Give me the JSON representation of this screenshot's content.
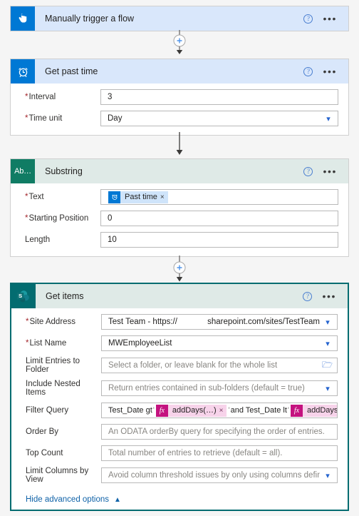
{
  "trigger_card": {
    "title": "Manually trigger a flow",
    "icon": "tap-hand-icon",
    "help": "?",
    "menu": "•••"
  },
  "past_time_card": {
    "title": "Get past time",
    "icon": "alarm-clock-icon",
    "help": "?",
    "menu": "•••",
    "fields": [
      {
        "label": "Interval",
        "required": true,
        "value": "3",
        "control": "text"
      },
      {
        "label": "Time unit",
        "required": true,
        "value": "Day",
        "control": "dropdown"
      }
    ]
  },
  "substring_card": {
    "title": "Substring",
    "icon_text": "Ab…",
    "help": "?",
    "menu": "•••",
    "text_label": "Text",
    "text_token": {
      "icon": "alarm-clock-icon",
      "label": "Past time",
      "remove": "×"
    },
    "fields": [
      {
        "label": "Starting Position",
        "required": true,
        "value": "0",
        "control": "text"
      },
      {
        "label": "Length",
        "required": false,
        "value": "10",
        "control": "text"
      }
    ]
  },
  "get_items_card": {
    "title": "Get items",
    "icon": "sharepoint-icon",
    "help": "?",
    "menu": "•••",
    "site_address": {
      "label": "Site Address",
      "value_prefix": "Test Team - https://",
      "value_suffix": "sharepoint.com/sites/TestTeam"
    },
    "list_name": {
      "label": "List Name",
      "value": "MWEmployeeList"
    },
    "limit_entries": {
      "label": "Limit Entries to Folder",
      "placeholder": "Select a folder, or leave blank for the whole list"
    },
    "include_nested": {
      "label": "Include Nested Items",
      "placeholder": "Return entries contained in sub-folders (default = true)"
    },
    "filter_query": {
      "label": "Filter Query",
      "part1": "Test_Date gt",
      "token1": {
        "icon": "fx-icon",
        "label": "addDays(…)",
        "remove": "×"
      },
      "part2": "and Test_Date lt",
      "token2": {
        "icon": "fx-icon",
        "label": "addDays(…)",
        "remove": "×"
      },
      "quote": "'"
    },
    "order_by": {
      "label": "Order By",
      "placeholder": "An ODATA orderBy query for specifying the order of entries."
    },
    "top_count": {
      "label": "Top Count",
      "placeholder": "Total number of entries to retrieve (default = all)."
    },
    "limit_columns": {
      "label": "Limit Columns by View",
      "placeholder": "Avoid column threshold issues by only using columns defined in a view"
    },
    "advanced_link": {
      "label": "Hide advanced options",
      "caret": "⌃"
    }
  },
  "colors": {
    "trigger_blue": "#0078d4",
    "header_blue": "#d9e7fb",
    "substring_green": "#107c64",
    "header_mint": "#dfeae7",
    "sharepoint_teal": "#036c70",
    "expression_magenta": "#c4137f",
    "token_blue": "#cfe4fa",
    "required_red": "#a4262c",
    "link_blue": "#0f62a8",
    "canvas_gray": "#f5f5f5"
  }
}
